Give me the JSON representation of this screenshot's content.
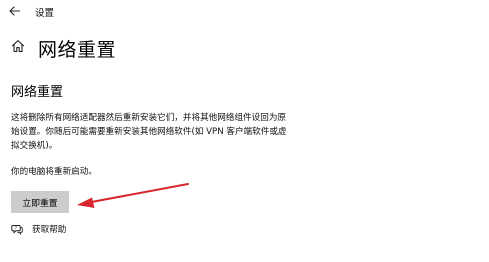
{
  "window": {
    "title": "设置",
    "back_icon": "back-arrow-icon"
  },
  "header": {
    "home_icon": "home-icon",
    "page_title": "网络重置"
  },
  "main": {
    "section_title": "网络重置",
    "description_lines": [
      "这将删除所有网络适配器然后重新安装它们，并将其他网络组件设回为原",
      "始设置。你随后可能需要重新安装其他网络软件(如 VPN 客户端软件或虚",
      "拟交换机)。"
    ],
    "restart_note": "你的电脑将重新启动。",
    "reset_button_label": "立即重置"
  },
  "help": {
    "icon": "chat-help-icon",
    "label": "获取帮助"
  },
  "annotation": {
    "arrow_color": "#d9262c"
  },
  "colors": {
    "button_background": "#cccccc",
    "page_background": "#ffffff"
  }
}
